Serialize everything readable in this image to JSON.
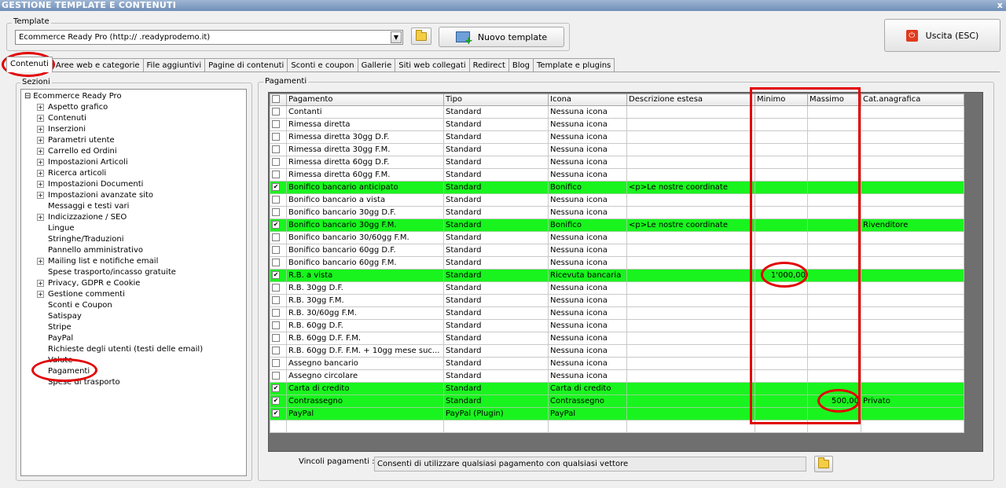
{
  "window": {
    "title": "GESTIONE TEMPLATE E CONTENUTI",
    "close": "x"
  },
  "template": {
    "legend": "Template",
    "value": "Ecommerce Ready Pro (http://       .readyprodemo.it)",
    "new_label": "Nuovo template",
    "exit_label": "Uscita (ESC)"
  },
  "tabs": [
    "Contenuti",
    "Aree web e categorie",
    "File aggiuntivi",
    "Pagine di contenuti",
    "Sconti e coupon",
    "Gallerie",
    "Siti web collegati",
    "Redirect",
    "Blog",
    "Template e plugins"
  ],
  "sections": {
    "legend": "Sezioni",
    "root": "Ecommerce Ready Pro",
    "items": [
      {
        "label": "Aspetto grafico",
        "expandable": true
      },
      {
        "label": "Contenuti",
        "expandable": true
      },
      {
        "label": "Inserzioni",
        "expandable": true
      },
      {
        "label": "Parametri utente",
        "expandable": true
      },
      {
        "label": "Carrello ed Ordini",
        "expandable": true
      },
      {
        "label": "Impostazioni Articoli",
        "expandable": true
      },
      {
        "label": "Ricerca articoli",
        "expandable": true
      },
      {
        "label": "Impostazioni Documenti",
        "expandable": true
      },
      {
        "label": "Impostazioni avanzate sito",
        "expandable": true
      },
      {
        "label": "Messaggi e testi vari",
        "expandable": false
      },
      {
        "label": "Indicizzazione / SEO",
        "expandable": true
      },
      {
        "label": "Lingue",
        "expandable": false
      },
      {
        "label": "Stringhe/Traduzioni",
        "expandable": false
      },
      {
        "label": "Pannello amministrativo",
        "expandable": false
      },
      {
        "label": "Mailing list e notifiche email",
        "expandable": true
      },
      {
        "label": "Spese trasporto/incasso gratuite",
        "expandable": false
      },
      {
        "label": "Privacy, GDPR e Cookie",
        "expandable": true
      },
      {
        "label": "Gestione commenti",
        "expandable": true
      },
      {
        "label": "Sconti e Coupon",
        "expandable": false
      },
      {
        "label": "Satispay",
        "expandable": false
      },
      {
        "label": "Stripe",
        "expandable": false
      },
      {
        "label": "PayPal",
        "expandable": false
      },
      {
        "label": "Richieste degli utenti (testi delle email)",
        "expandable": false
      },
      {
        "label": "Valute",
        "expandable": false
      },
      {
        "label": "Pagamenti",
        "expandable": false
      },
      {
        "label": "Spese di trasporto",
        "expandable": false
      }
    ]
  },
  "payments": {
    "legend": "Pagamenti",
    "columns": [
      "Pagamento",
      "Tipo",
      "Icona",
      "Descrizione estesa",
      "Minimo",
      "Massimo",
      "Cat.anagrafica"
    ],
    "rows": [
      {
        "checked": false,
        "cells": [
          "Contanti",
          "Standard",
          "Nessuna icona",
          "",
          "",
          "",
          ""
        ]
      },
      {
        "checked": false,
        "cells": [
          "Rimessa diretta",
          "Standard",
          "Nessuna icona",
          "",
          "",
          "",
          ""
        ]
      },
      {
        "checked": false,
        "cells": [
          "Rimessa diretta 30gg D.F.",
          "Standard",
          "Nessuna icona",
          "",
          "",
          "",
          ""
        ]
      },
      {
        "checked": false,
        "cells": [
          "Rimessa diretta 30gg F.M.",
          "Standard",
          "Nessuna icona",
          "",
          "",
          "",
          ""
        ]
      },
      {
        "checked": false,
        "cells": [
          "Rimessa diretta 60gg D.F.",
          "Standard",
          "Nessuna icona",
          "",
          "",
          "",
          ""
        ]
      },
      {
        "checked": false,
        "cells": [
          "Rimessa diretta 60gg F.M.",
          "Standard",
          "Nessuna icona",
          "",
          "",
          "",
          ""
        ]
      },
      {
        "checked": true,
        "cells": [
          "Bonifico bancario anticipato",
          "Standard",
          "Bonifico",
          "<p>Le nostre coordinate",
          "",
          "",
          ""
        ]
      },
      {
        "checked": false,
        "cells": [
          "Bonifico bancario a vista",
          "Standard",
          "Nessuna icona",
          "",
          "",
          "",
          ""
        ]
      },
      {
        "checked": false,
        "cells": [
          "Bonifico bancario 30gg D.F.",
          "Standard",
          "Nessuna icona",
          "",
          "",
          "",
          ""
        ]
      },
      {
        "checked": true,
        "cells": [
          "Bonifico bancario 30gg F.M.",
          "Standard",
          "Bonifico",
          "<p>Le nostre coordinate",
          "",
          "",
          "Rivenditore"
        ]
      },
      {
        "checked": false,
        "cells": [
          "Bonifico bancario 30/60gg F.M.",
          "Standard",
          "Nessuna icona",
          "",
          "",
          "",
          ""
        ]
      },
      {
        "checked": false,
        "cells": [
          "Bonifico bancario 60gg D.F.",
          "Standard",
          "Nessuna icona",
          "",
          "",
          "",
          ""
        ]
      },
      {
        "checked": false,
        "cells": [
          "Bonifico bancario 60gg F.M.",
          "Standard",
          "Nessuna icona",
          "",
          "",
          "",
          ""
        ]
      },
      {
        "checked": true,
        "cells": [
          "R.B. a vista",
          "Standard",
          "Ricevuta bancaria",
          "",
          "1'000,00",
          "",
          ""
        ]
      },
      {
        "checked": false,
        "cells": [
          "R.B. 30gg D.F.",
          "Standard",
          "Nessuna icona",
          "",
          "",
          "",
          ""
        ]
      },
      {
        "checked": false,
        "cells": [
          "R.B. 30gg F.M.",
          "Standard",
          "Nessuna icona",
          "",
          "",
          "",
          ""
        ]
      },
      {
        "checked": false,
        "cells": [
          "R.B. 30/60gg F.M.",
          "Standard",
          "Nessuna icona",
          "",
          "",
          "",
          ""
        ]
      },
      {
        "checked": false,
        "cells": [
          "R.B. 60gg D.F.",
          "Standard",
          "Nessuna icona",
          "",
          "",
          "",
          ""
        ]
      },
      {
        "checked": false,
        "cells": [
          "R.B. 60gg D.F. F.M.",
          "Standard",
          "Nessuna icona",
          "",
          "",
          "",
          ""
        ]
      },
      {
        "checked": false,
        "cells": [
          "R.B. 60gg D.F. F.M. + 10gg mese suc...",
          "Standard",
          "Nessuna icona",
          "",
          "",
          "",
          ""
        ]
      },
      {
        "checked": false,
        "cells": [
          "Assegno bancario",
          "Standard",
          "Nessuna icona",
          "",
          "",
          "",
          ""
        ]
      },
      {
        "checked": false,
        "cells": [
          "Assegno circolare",
          "Standard",
          "Nessuna icona",
          "",
          "",
          "",
          ""
        ]
      },
      {
        "checked": true,
        "cells": [
          "Carta di credito",
          "Standard",
          "Carta di credito",
          "",
          "",
          "",
          ""
        ]
      },
      {
        "checked": true,
        "cells": [
          "Contrassegno",
          "Standard",
          "Contrassegno",
          "",
          "",
          "500,00",
          "Privato"
        ]
      },
      {
        "checked": true,
        "cells": [
          "PayPal",
          "PayPal (Plugin)",
          "PayPal",
          "",
          "",
          "",
          ""
        ]
      }
    ]
  },
  "vincoli": {
    "label": "Vincoli pagamenti :",
    "value": "Consenti di utilizzare qualsiasi pagamento con qualsiasi vettore"
  },
  "colors": {
    "active_row": "#19f41e",
    "highlight": "#e20000"
  }
}
